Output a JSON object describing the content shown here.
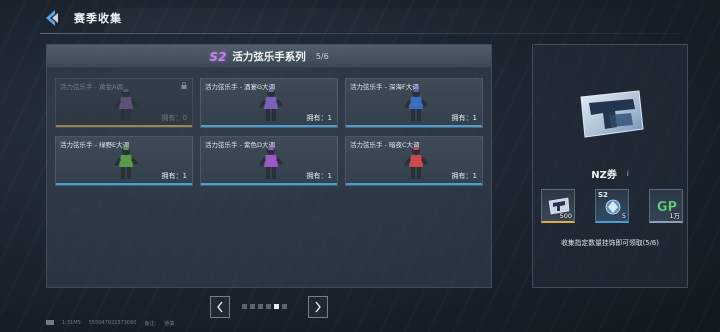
{
  "header": {
    "title": "赛季收集",
    "back_icon": "back-arrow-icon"
  },
  "series": {
    "badge": "S2",
    "title": "活力弦乐手系列",
    "progress": "5/6",
    "owned_prefix": "拥有："
  },
  "cards": [
    {
      "name": "活力弦乐手 - 黄金A调",
      "owned": "0",
      "locked": true,
      "figure_color": "#6a5a86"
    },
    {
      "name": "活力弦乐手 - 酒宴G大调",
      "owned": "1",
      "locked": false,
      "figure_color": "#7a62b8"
    },
    {
      "name": "活力弦乐手 - 深海F大调",
      "owned": "1",
      "locked": false,
      "figure_color": "#3a6cc4"
    },
    {
      "name": "活力弦乐手 - 绿野E大调",
      "owned": "1",
      "locked": false,
      "figure_color": "#5a9a4a"
    },
    {
      "name": "活力弦乐手 - 紫色D大调",
      "owned": "1",
      "locked": false,
      "figure_color": "#9a58c8"
    },
    {
      "name": "活力弦乐手 - 暗夜C大调",
      "owned": "1",
      "locked": false,
      "figure_color": "#c84a4a"
    }
  ],
  "pager": {
    "dots": 6,
    "active_index": 4
  },
  "footer": {
    "uid": "1:31MS",
    "server": "555047922373060",
    "note_label": "备注:",
    "note_value": "待填"
  },
  "reward_panel": {
    "item_name": "NZ券",
    "info_icon": "i",
    "rewards": [
      {
        "tag": "",
        "count": "500",
        "icon": "nz-ticket-icon"
      },
      {
        "tag": "S2",
        "count": "5",
        "icon": "s2-crystal-icon"
      },
      {
        "tag": "",
        "count": "1万",
        "icon": "gp-coin-icon"
      }
    ],
    "hint": "收集指定数量挂饰即可领取(5/6)"
  },
  "colors": {
    "accent_blue": "#4a9ecf",
    "accent_gold": "#c0a04a",
    "s2_purple": "#c08be8"
  }
}
